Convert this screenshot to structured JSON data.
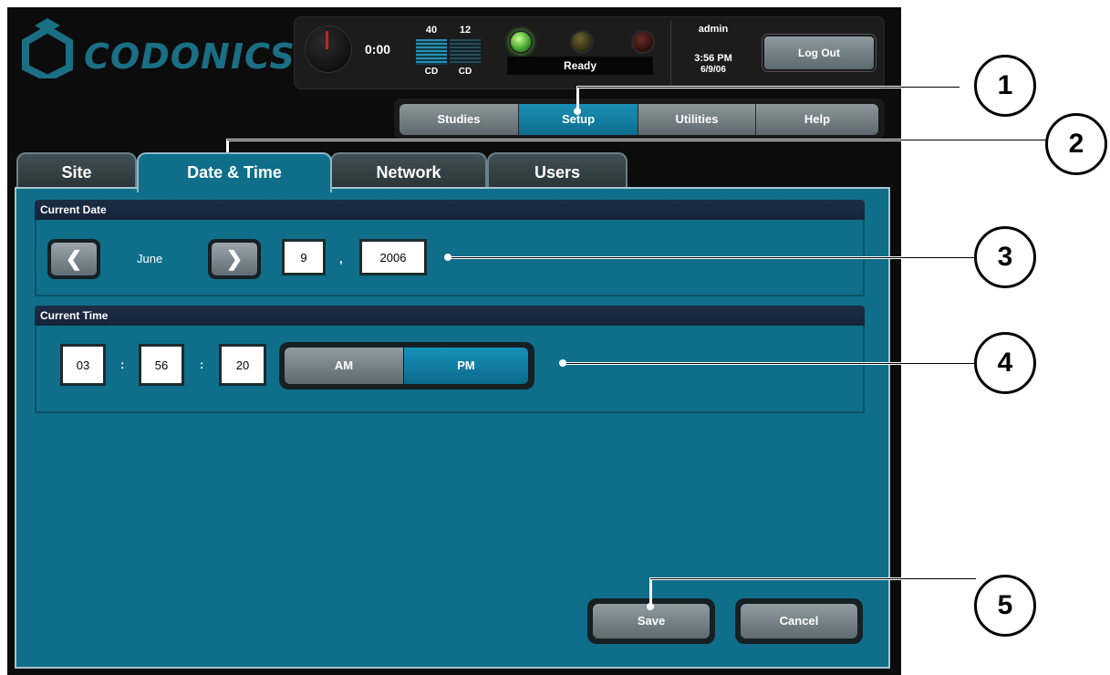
{
  "brand": {
    "name": "CODONICS"
  },
  "status": {
    "timer": "0:00",
    "media": [
      {
        "count": "40",
        "type": "CD"
      },
      {
        "count": "12",
        "type": "CD"
      }
    ],
    "printer_status": "Ready",
    "user": "admin",
    "time": "3:56 PM",
    "date": "6/9/06",
    "logout_label": "Log Out"
  },
  "nav": {
    "tabs": [
      "Studies",
      "Setup",
      "Utilities",
      "Help"
    ],
    "active": "Setup"
  },
  "subtabs": {
    "tabs": [
      "Site",
      "Date & Time",
      "Network",
      "Users"
    ],
    "active": "Date & Time"
  },
  "current_date": {
    "heading": "Current Date",
    "month": "June",
    "day": "9",
    "date_separator": ",",
    "year": "2006",
    "prev_icon": "chevron-left-icon",
    "next_icon": "chevron-right-icon"
  },
  "current_time": {
    "heading": "Current Time",
    "hour": "03",
    "minute": "56",
    "second": "20",
    "time_separator": ":",
    "am_label": "AM",
    "pm_label": "PM",
    "selected_period": "PM"
  },
  "actions": {
    "save_label": "Save",
    "cancel_label": "Cancel"
  },
  "callouts": [
    "1",
    "2",
    "3",
    "4",
    "5"
  ],
  "colors": {
    "panel": "#0f6f8a",
    "active_tab": "#1a8fb5",
    "header_bar": "#1c2d43"
  }
}
